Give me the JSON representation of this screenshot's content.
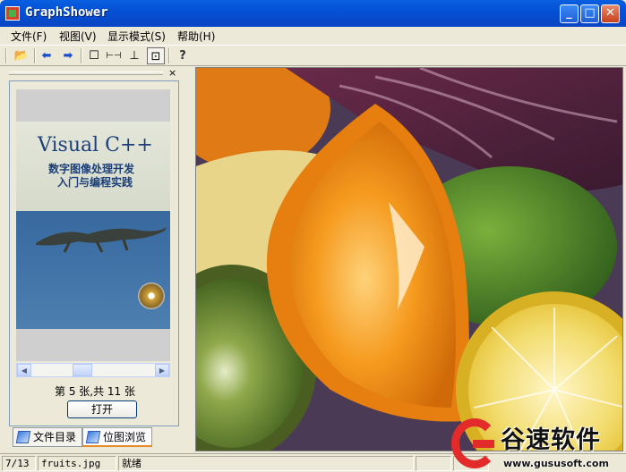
{
  "window": {
    "title": "GraphShower",
    "controls": {
      "minimize": "_",
      "maximize": "□",
      "close": "✕"
    }
  },
  "menu": [
    "文件(F)",
    "视图(V)",
    "显示模式(S)",
    "帮助(H)"
  ],
  "toolbar": {
    "icons": [
      "open-folder-icon",
      "arrow-left-icon",
      "arrow-right-icon",
      "original-size-icon",
      "fit-width-icon",
      "fit-height-icon",
      "fit-window-icon",
      "help-icon"
    ],
    "glyphs": {
      "open": "📂",
      "prev": "⬅",
      "next": "➡",
      "original": "☐",
      "fit_width": "⊢⊣",
      "fit_height": "⊥",
      "fit_window": "⊡",
      "help": "?"
    },
    "active": "fit-window"
  },
  "panel": {
    "close_glyph": "×",
    "thumbnail": {
      "cover_title": "Visual C++",
      "cover_subtitle": [
        "数字图像处理开发",
        "入门与编程实践"
      ]
    },
    "scroll_glyphs": {
      "left": "◀",
      "right": "▶"
    },
    "page_info": "第 5 张,共 11 张",
    "open_button": "打开",
    "tabs": [
      "文件目录",
      "位图浏览"
    ],
    "active_tab": "位图浏览"
  },
  "status": {
    "index": "7/13",
    "filename": "fruits.jpg",
    "state": "就绪",
    "extra1": "",
    "extra2": ""
  },
  "watermark": {
    "brand": "谷速软件",
    "url": "www.gususoft.com"
  },
  "colors": {
    "titlebar": "#0451d6",
    "watermark_red": "#e32b2b"
  }
}
